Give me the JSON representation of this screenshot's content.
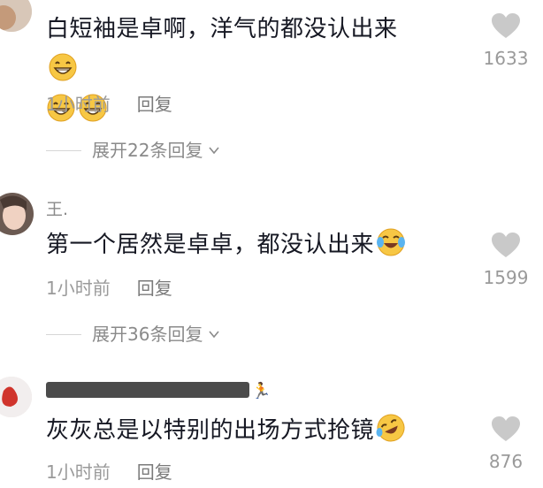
{
  "comments": [
    {
      "username": "",
      "text_line1": "白短袖是卓啊，洋气的都没认出来",
      "time": "1小时前",
      "reply_label": "回复",
      "likes": "1633",
      "expand_label": "展开22条回复",
      "emoji_line1": "grin-emoji",
      "emoji_line2": [
        "grin-emoji",
        "grin-emoji"
      ]
    },
    {
      "username": "王.",
      "text_line1": "第一个居然是卓卓，都没认出来",
      "time": "1小时前",
      "reply_label": "回复",
      "likes": "1599",
      "expand_label": "展开36条回复",
      "emoji_line1": "crying-laughing-emoji"
    },
    {
      "username": "",
      "text_line1": "灰灰总是以特别的出场方式抢镜",
      "time": "1小时前",
      "reply_label": "回复",
      "likes": "876",
      "emoji_line1": "rolling-laughing-emoji"
    }
  ],
  "colors": {
    "text": "#161823",
    "meta": "#9a9a9a",
    "heart": "#c9c9c9"
  }
}
